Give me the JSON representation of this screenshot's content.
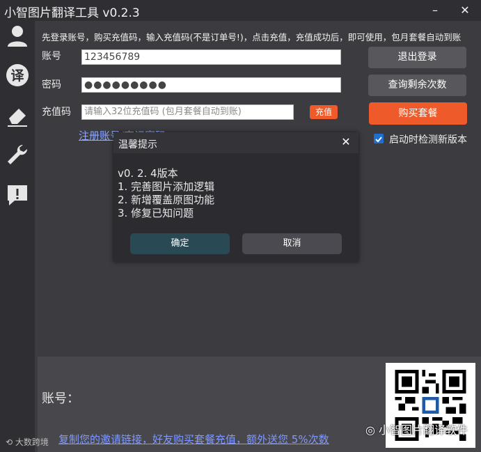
{
  "window": {
    "title": "小智图片翻译工具 v0.2.3",
    "minimize_icon": "minimize-icon",
    "close_icon": "close-icon"
  },
  "sidebar": {
    "items": [
      {
        "icon": "user-icon"
      },
      {
        "icon": "translate-icon",
        "glyph": "译"
      },
      {
        "icon": "eraser-icon"
      },
      {
        "icon": "wrench-icon"
      },
      {
        "icon": "alert-icon",
        "glyph": "!"
      }
    ]
  },
  "account": {
    "notice": "先登录账号，购买充值码，输入充值码(不是订单号!)，点击充值，充值成功后，即可使用，包月套餐自动到账",
    "username_label": "账号",
    "username_value": "123456789",
    "password_label": "密码",
    "password_value": "●●●●●●●●●",
    "code_label": "充值码",
    "code_placeholder": "请输入32位充值码 (包月套餐自动到账)",
    "charge_button": "充值",
    "register_link": "注册账号/忘记密码",
    "logout_button": "退出登录",
    "query_button": "查询剩余次数",
    "buy_button": "购买套餐",
    "check_update_label": "启动时检测新版本",
    "check_update_checked": true
  },
  "dialog": {
    "title": "温馨提示",
    "lines": [
      "v0. 2. 4版本",
      "1. 完善图片添加逻辑",
      "2. 新增覆盖原图功能",
      "3. 修复已知问题"
    ],
    "ok_button": "确定",
    "cancel_button": "取消"
  },
  "bottom": {
    "account_label": "账号：",
    "invite_text": "复制您的邀请链接，好友购买套餐充值，额外送您  5%次数"
  },
  "watermarks": {
    "right": "小智图片翻译软件",
    "left": "大数跨境"
  },
  "colors": {
    "accent_orange": "#ef5a2a",
    "link_blue": "#8ea8ff",
    "checkbox_blue": "#1e6fd0"
  }
}
